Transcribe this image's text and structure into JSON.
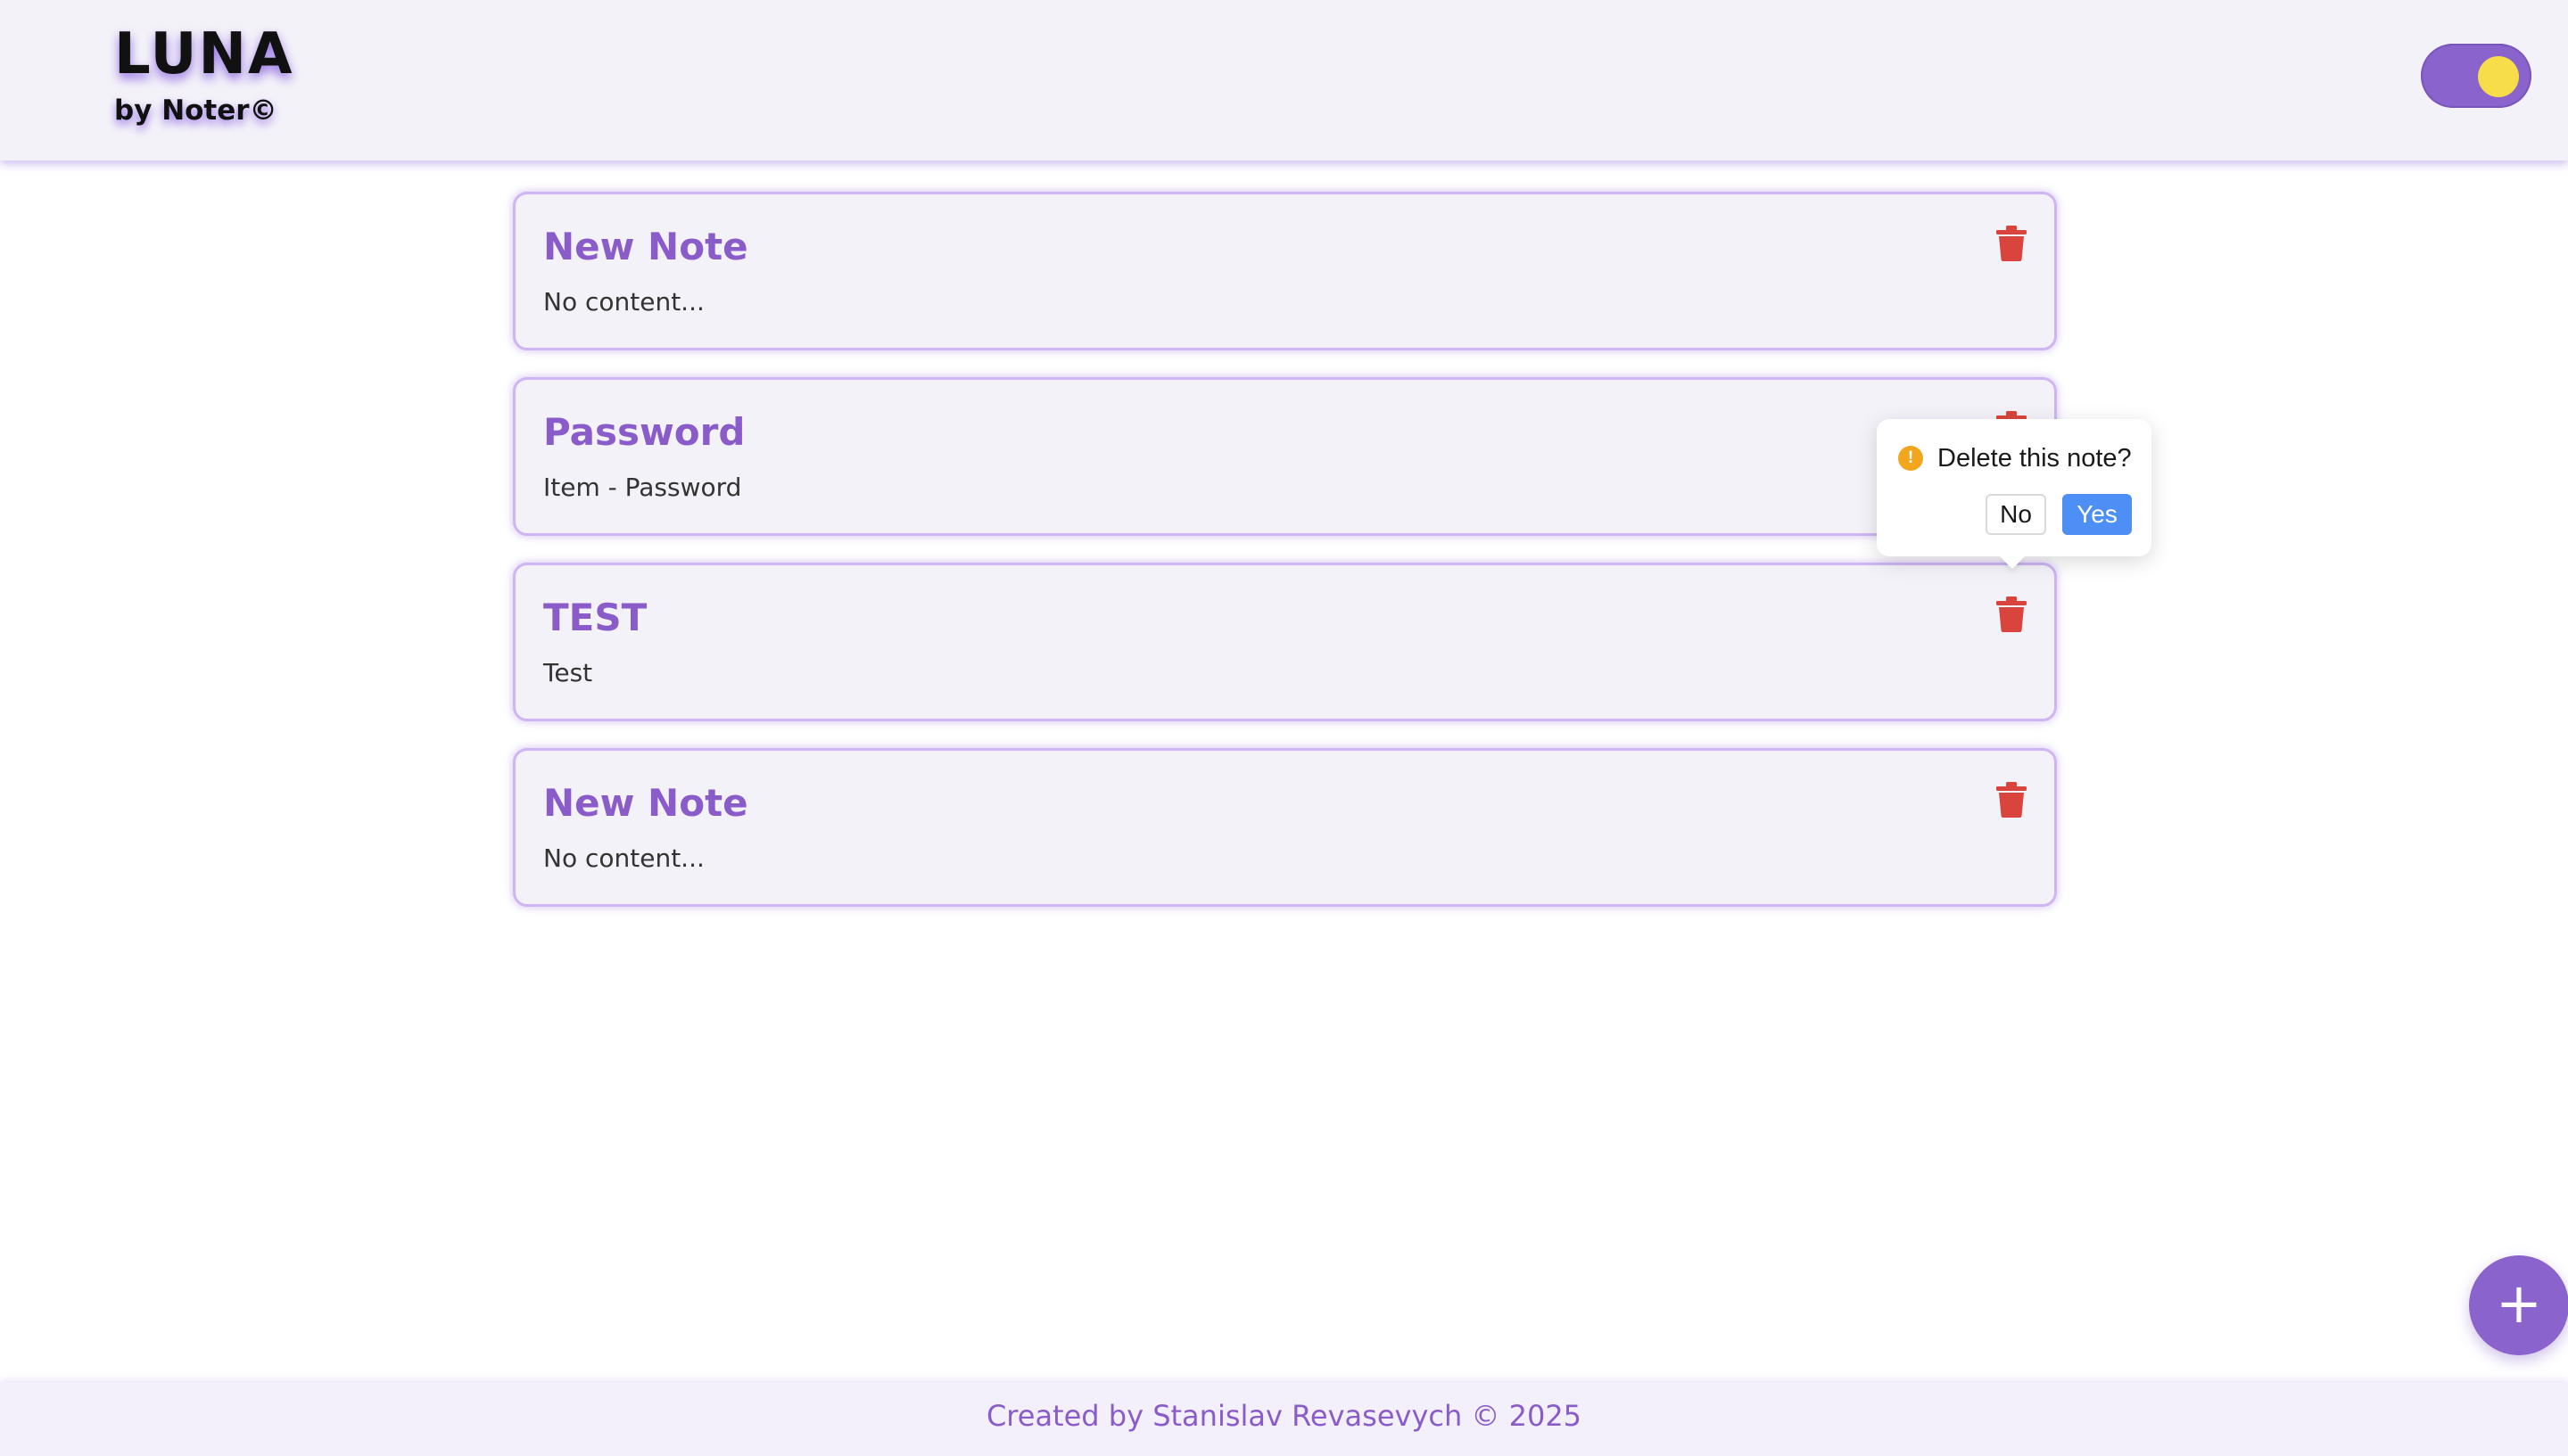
{
  "header": {
    "logo_title": "LUNA",
    "logo_subtitle": "by Noter©",
    "theme_toggle_state": "on"
  },
  "notes": [
    {
      "title": "New Note",
      "content": "No content..."
    },
    {
      "title": "Password",
      "content": "Item - Password"
    },
    {
      "title": "TEST",
      "content": "Test"
    },
    {
      "title": "New Note",
      "content": "No content..."
    }
  ],
  "confirm_popup": {
    "message": "Delete this note?",
    "no_label": "No",
    "yes_label": "Yes",
    "target_note_index": 1
  },
  "fab": {
    "label": "+"
  },
  "footer": {
    "text": "Created by Stanislav Revasevych © 2025"
  },
  "colors": {
    "accent": "#8a5cc9",
    "toggle": "#8a63cc",
    "toggle_knob": "#f7dd4a",
    "delete": "#d9443c",
    "confirm_primary": "#4d8ff5",
    "warning": "#f2a61d"
  },
  "icons": {
    "delete": "trash-icon",
    "warning": "exclamation-circle-icon",
    "add": "plus-icon"
  }
}
